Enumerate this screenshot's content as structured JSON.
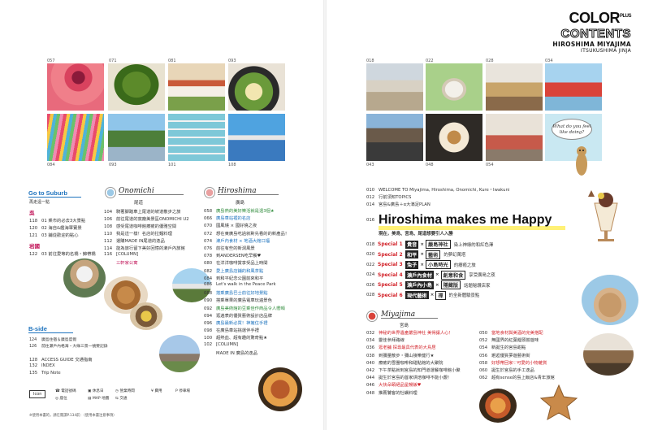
{
  "brand": {
    "logo": "COLOR",
    "logo_sup": "PLUS",
    "contents": "CONTENTS",
    "sub1": "HIROSHIMA MIYAJIMA",
    "sub2": "ITSUKUSHIMA JINJA"
  },
  "photos_left": {
    "top": [
      "057",
      "071",
      "081",
      "093"
    ],
    "bottom": [
      "084",
      "093",
      "101",
      "108"
    ]
  },
  "photos_right": {
    "top": [
      "018",
      "022",
      "028",
      "034"
    ],
    "bottom": [
      "043",
      "048",
      "054",
      "032"
    ]
  },
  "bubble": "What do you feel like doing?",
  "suburb": {
    "title": "Go to Suburb",
    "subtitle": "再走遠一點",
    "region1": "吳",
    "items1": [
      {
        "page": "118",
        "text": "01 乘市的必去3大景點"
      },
      {
        "page": "120",
        "text": "02 海自&艦海軍實景"
      },
      {
        "page": "121",
        "text": "03 鋪從歡迎的點心"
      }
    ],
    "region2": "岩國",
    "items2": [
      {
        "page": "122",
        "text": "03 前往愛等的名橋・錦帶橋"
      }
    ]
  },
  "onomichi": {
    "title": "Onomichi",
    "subtitle": "尾道",
    "items": [
      {
        "page": "104",
        "text": "騎著腳踏車上尾道的坡道散步之旅"
      },
      {
        "page": "106",
        "text": "前往尾道的窯廠美景區ONOMICHI U2"
      },
      {
        "page": "108",
        "text": "感受尾道咖啡館療癒的優雅空間"
      },
      {
        "page": "110",
        "text": "我是這一樣！名店的拉麵料理"
      },
      {
        "page": "112",
        "text": "選購MADE IN尾道的逸品"
      },
      {
        "page": "114",
        "text": "能為旅行留下美好回憶的瀨戶內旅館"
      },
      {
        "page": "116",
        "text": "[COLUMN]"
      },
      {
        "page": "",
        "text": "三軒家公寓"
      }
    ]
  },
  "bside": {
    "title": "B-side",
    "items": [
      {
        "page": "124",
        "text": "廣島住宿＆廣島度假"
      },
      {
        "page": "126",
        "text": "前往瀨戶內格海・大綠三景一號要記錄"
      }
    ]
  },
  "access": [
    {
      "page": "128",
      "text": "ACCESS GUIDE 交通指南"
    },
    {
      "page": "132",
      "text": "INDEX"
    },
    {
      "page": "135",
      "text": "Trip Note"
    }
  ],
  "icon_legend": {
    "label": "Icon",
    "items": [
      "電話號碼",
      "休息日",
      "營業時間",
      "費用",
      "停車場",
      "座位",
      "MAP 地圖",
      "交通"
    ]
  },
  "note": "※使用本書的，請在閱讀P.134前：（使用本書注意事項）",
  "hiroshima": {
    "title": "Hiroshima",
    "subtitle": "廣島",
    "items": [
      {
        "page": "058",
        "text": "廣島熱的美好樂活就是遠3個★"
      },
      {
        "page": "066",
        "text": "廣島車站裡的名店"
      },
      {
        "page": "070",
        "text": "國風燒 × 國好燒之夜"
      },
      {
        "page": "072",
        "text": "想在東廣島吃過就對先看的的新產品！"
      },
      {
        "page": "074",
        "text": "瀨戶內食材 × 地酒大館口福"
      },
      {
        "page": "076",
        "text": "前往有些的新潟風景"
      },
      {
        "page": "078",
        "text": "到ANDERSEN吃早餐♥"
      },
      {
        "page": "080",
        "text": "在洋洋咖啡賞享受品上時間"
      },
      {
        "page": "082",
        "text": "愛上廣島店鋪的和風茶點"
      },
      {
        "page": "084",
        "text": "到和平紀念公園前來和平"
      },
      {
        "page": "086",
        "text": "Let's walk in the Peace Park"
      },
      {
        "page": "088",
        "text": "搭乘廣島巴士前往好地景點"
      },
      {
        "page": "090",
        "text": "搭乘單果的廣島電車玩遍景色"
      },
      {
        "page": "092",
        "text": "廣島美術館的豆乘佳作商品令人嚮噸"
      },
      {
        "page": "094",
        "text": "逛遍表的優質藝術設計店品牌"
      },
      {
        "page": "096",
        "text": "廣島最新必買！神擁住手禮"
      },
      {
        "page": "098",
        "text": "在廣島車站挑選伴手禮"
      },
      {
        "page": "100",
        "text": "超熱血、超有趣的驚奇點★"
      },
      {
        "page": "102",
        "text": "[COLUMN]"
      },
      {
        "page": "",
        "text": "MADE IN 廣島的逸品"
      }
    ]
  },
  "intro": [
    {
      "page": "010",
      "text": "WELCOME TO Miyajima, Hiroshima, Onomichi, Kure・Iwakuni"
    },
    {
      "page": "012",
      "text": "行前須知TOPICS"
    },
    {
      "page": "014",
      "text": "宮島&廣島＋α大滿足PLAN"
    }
  ],
  "headline": {
    "page": "016",
    "text": "Hiroshima makes me Happy",
    "sub": "現在，美島、宮島、尾道想要引人入勝"
  },
  "specials": [
    {
      "page": "018",
      "label": "Special 1",
      "a": "貴音",
      "b": "嚴島神社",
      "desc": "染上神綠的和紅色澤"
    },
    {
      "page": "020",
      "label": "Special 2",
      "a": "和平",
      "b": "藝術",
      "desc": "的夢幻萬塔"
    },
    {
      "page": "022",
      "label": "Special 3",
      "a": "兔子",
      "b": "小島時光",
      "desc": "的療癒之旅"
    },
    {
      "page": "024",
      "label": "Special 4",
      "a": "瀨戶內食材",
      "b": "創意和食",
      "desc": "享受廣島之夜"
    },
    {
      "page": "026",
      "label": "Special 5",
      "a": "瀨戶內小島",
      "b": "隱藏版",
      "desc": "話題秘讚店家"
    },
    {
      "page": "028",
      "label": "Special 6",
      "a": "現代藝術",
      "b": "禪",
      "desc": "的全新體驗景點"
    }
  ],
  "miyajima": {
    "title": "Miyajima",
    "subtitle": "宮島",
    "col1": [
      {
        "page": "032",
        "text": "神秘的世界遺產嚴島神社 美得讓人心！"
      },
      {
        "page": "034",
        "text": "靈佳參拜路線"
      },
      {
        "page": "036",
        "text": "逛老舖 探尋最具代表的大鳥居"
      },
      {
        "page": "038",
        "text": "到彌量散步・彌山接樂健行★"
      },
      {
        "page": "040",
        "text": "療癒的雪團咖啡和甜點館的大聚院"
      },
      {
        "page": "042",
        "text": "下午茶點就到宮島的知門道選餐咖啡館小聚"
      },
      {
        "page": "044",
        "text": "誕生於宮島的首家烘焙咖啡不能小覷！"
      },
      {
        "page": "046",
        "text": "大快朵頤絕品星鰻飯♥"
      },
      {
        "page": "048",
        "text": "推薦饕客的牡蠣料理"
      }
    ],
    "col2": [
      {
        "page": "050",
        "text": "當地食材與美酒的完美搭配"
      },
      {
        "page": "052",
        "text": "無國界的紅葉饅頭嘗遊味"
      },
      {
        "page": "054",
        "text": "新誕生的宮島甜點"
      },
      {
        "page": "056",
        "text": "邂逅優質夢遊藝術街"
      },
      {
        "page": "058",
        "text": "好想帶回家♡可愛的小物雜貨"
      },
      {
        "page": "060",
        "text": "誕生於宮島的手工逸品"
      },
      {
        "page": "062",
        "text": "超有sense的島上飯店&青年旅館"
      }
    ]
  }
}
